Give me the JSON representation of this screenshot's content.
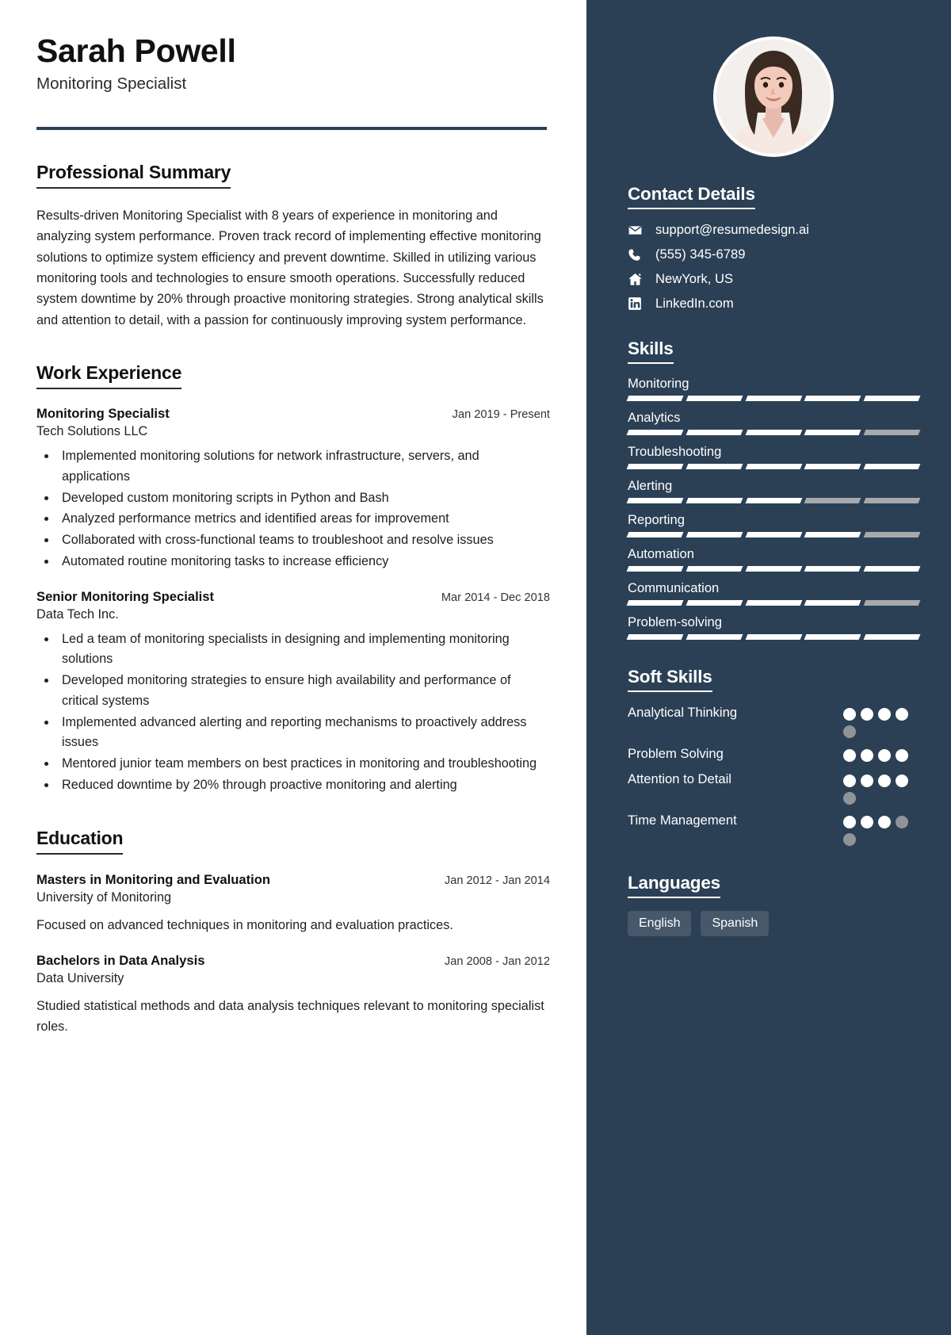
{
  "header": {
    "name": "Sarah Powell",
    "role": "Monitoring Specialist"
  },
  "sections": {
    "summary_title": "Professional Summary",
    "summary_text": "Results-driven Monitoring Specialist with 8 years of experience in monitoring and analyzing system performance. Proven track record of implementing effective monitoring solutions to optimize system efficiency and prevent downtime. Skilled in utilizing various monitoring tools and technologies to ensure smooth operations. Successfully reduced system downtime by 20% through proactive monitoring strategies. Strong analytical skills and attention to detail, with a passion for continuously improving system performance.",
    "experience_title": "Work Experience",
    "education_title": "Education"
  },
  "experience": [
    {
      "title": "Monitoring Specialist",
      "date": "Jan 2019 - Present",
      "company": "Tech Solutions LLC",
      "bullets": [
        "Implemented monitoring solutions for network infrastructure, servers, and applications",
        "Developed custom monitoring scripts in Python and Bash",
        "Analyzed performance metrics and identified areas for improvement",
        "Collaborated with cross-functional teams to troubleshoot and resolve issues",
        "Automated routine monitoring tasks to increase efficiency"
      ]
    },
    {
      "title": "Senior Monitoring Specialist",
      "date": "Mar 2014 - Dec 2018",
      "company": "Data Tech Inc.",
      "bullets": [
        "Led a team of monitoring specialists in designing and implementing monitoring solutions",
        "Developed monitoring strategies to ensure high availability and performance of critical systems",
        "Implemented advanced alerting and reporting mechanisms to proactively address issues",
        "Mentored junior team members on best practices in monitoring and troubleshooting",
        "Reduced downtime by 20% through proactive monitoring and alerting"
      ]
    }
  ],
  "education": [
    {
      "degree": "Masters in Monitoring and Evaluation",
      "date": "Jan 2012 - Jan 2014",
      "school": "University of Monitoring",
      "description": "Focused on advanced techniques in monitoring and evaluation practices."
    },
    {
      "degree": "Bachelors in Data Analysis",
      "date": "Jan 2008 - Jan 2012",
      "school": "Data University",
      "description": "Studied statistical methods and data analysis techniques relevant to monitoring specialist roles."
    }
  ],
  "sidebar": {
    "contact_title": "Contact Details",
    "contact": [
      {
        "icon": "envelope-icon",
        "value": "support@resumedesign.ai"
      },
      {
        "icon": "phone-icon",
        "value": "(555) 345-6789"
      },
      {
        "icon": "home-icon",
        "value": "NewYork, US"
      },
      {
        "icon": "linkedin-icon",
        "value": "LinkedIn.com"
      }
    ],
    "skills_title": "Skills",
    "skills": [
      {
        "name": "Monitoring",
        "segments": 5,
        "filled": 5
      },
      {
        "name": "Analytics",
        "segments": 5,
        "filled": 4
      },
      {
        "name": "Troubleshooting",
        "segments": 5,
        "filled": 5
      },
      {
        "name": "Alerting",
        "segments": 5,
        "filled": 3
      },
      {
        "name": "Reporting",
        "segments": 5,
        "filled": 4
      },
      {
        "name": "Automation",
        "segments": 5,
        "filled": 5
      },
      {
        "name": "Communication",
        "segments": 5,
        "filled": 4
      },
      {
        "name": "Problem-solving",
        "segments": 5,
        "filled": 5
      }
    ],
    "soft_skills_title": "Soft Skills",
    "soft_skills": [
      {
        "name": "Analytical Thinking",
        "dots": 5,
        "filled": 4
      },
      {
        "name": "Problem Solving",
        "dots": 4,
        "filled": 4
      },
      {
        "name": "Attention to Detail",
        "dots": 5,
        "filled": 4
      },
      {
        "name": "Time Management",
        "dots": 5,
        "filled": 3
      }
    ],
    "languages_title": "Languages",
    "languages": [
      "English",
      "Spanish"
    ]
  },
  "colors": {
    "sidebar_bg": "#2b4055",
    "rule": "#2d4155",
    "fill": "#ffffff",
    "empty": "#a7a9ac",
    "chip_bg": "#47586b"
  }
}
